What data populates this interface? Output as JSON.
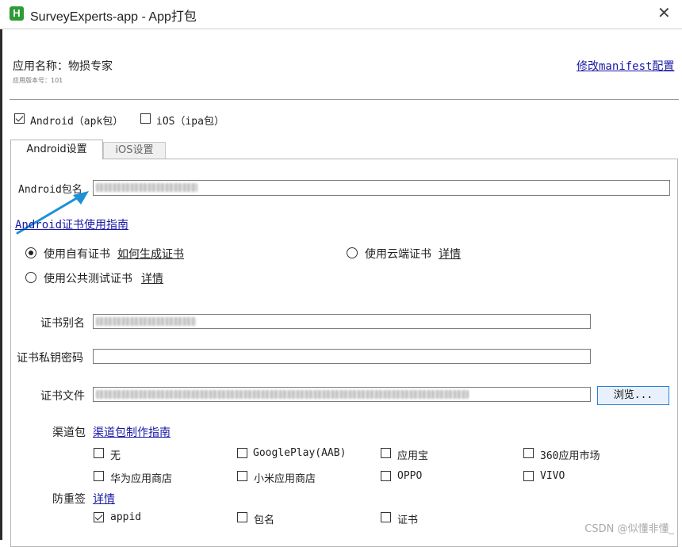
{
  "window": {
    "title": "SurveyExperts-app - App打包",
    "icon_label": "H",
    "close_symbol": "✕"
  },
  "header": {
    "app_name": "应用名称：物损专家",
    "app_version": "应用版本号：101",
    "modify_manifest": "修改manifest配置"
  },
  "platforms": [
    {
      "label": "Android（apk包）",
      "checked": true
    },
    {
      "label": "iOS（ipa包）",
      "checked": false
    }
  ],
  "tabs": [
    {
      "label": "Android设置",
      "active": true
    },
    {
      "label": "iOS设置",
      "active": false
    }
  ],
  "android": {
    "package_label": "Android包名",
    "cert_guide_link": "Android证书使用指南",
    "cert_options": {
      "own": {
        "label": "使用自有证书",
        "link": "如何生成证书",
        "selected": true
      },
      "cloud": {
        "label": "使用云端证书",
        "link": "详情",
        "selected": false
      },
      "public": {
        "label": "使用公共测试证书",
        "link": "详情",
        "selected": false
      }
    },
    "alias_label": "证书别名",
    "password_label": "证书私钥密码",
    "password_value": "",
    "file_label": "证书文件",
    "browse_button": "浏览...",
    "channel_label": "渠道包",
    "channel_link": "渠道包制作指南",
    "channels": [
      {
        "label": "无",
        "checked": false
      },
      {
        "label": "GooglePlay(AAB)",
        "checked": false
      },
      {
        "label": "应用宝",
        "checked": false
      },
      {
        "label": "360应用市场",
        "checked": false
      },
      {
        "label": "华为应用商店",
        "checked": false
      },
      {
        "label": "小米应用商店",
        "checked": false
      },
      {
        "label": "OPPO",
        "checked": false
      },
      {
        "label": "VIVO",
        "checked": false
      }
    ],
    "antitamper_label": "防重签",
    "antitamper_link": "详情",
    "antitamper": [
      {
        "label": "appid",
        "checked": true
      },
      {
        "label": "包名",
        "checked": false
      },
      {
        "label": "证书",
        "checked": false
      }
    ]
  },
  "watermark": "CSDN @似懂非懂_",
  "colors": {
    "link": "#1a1aa6",
    "arrow": "#1e90d8",
    "icon": "#2f9a36"
  }
}
